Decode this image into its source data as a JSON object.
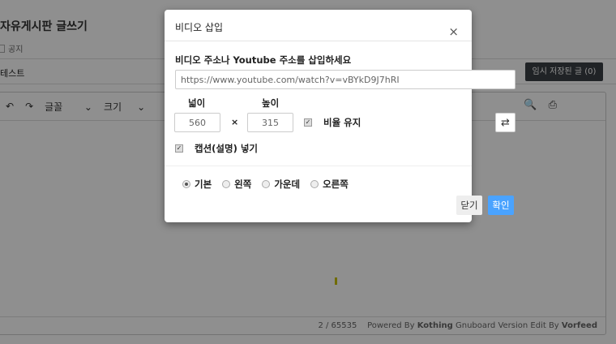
{
  "page": {
    "title": "자유게시판 글쓰기",
    "notice_label": "공지",
    "subject": "테스트",
    "temp_save": "임시 저장된 글 (0)"
  },
  "toolbar": {
    "font": "글꼴",
    "size": "크기"
  },
  "editor": {
    "count": "2 / 65535",
    "powered": "Powered By ",
    "kothing": "Kothing",
    "mid": " Gnuboard Version Edit By ",
    "vorfeed": "Vorfeed"
  },
  "modal": {
    "title": "비디오 삽입",
    "prompt": "비디오 주소나 Youtube 주소를 삽입하세요",
    "url": "https://www.youtube.com/watch?v=vBYkD9J7hRI",
    "width_label": "넓이",
    "height_label": "높이",
    "width": "560",
    "height": "315",
    "times": "×",
    "ratio": "비율 유지",
    "caption": "캡션(설명) 넣기",
    "align": [
      {
        "label": "기본",
        "checked": true
      },
      {
        "label": "왼쪽",
        "checked": false
      },
      {
        "label": "가운데",
        "checked": false
      },
      {
        "label": "오른쪽",
        "checked": false
      }
    ],
    "close_btn": "닫기",
    "ok_btn": "확인",
    "close_x": "×"
  },
  "colors": {
    "primary": "#4aa3ff",
    "overlay": "#8f8f8f"
  }
}
